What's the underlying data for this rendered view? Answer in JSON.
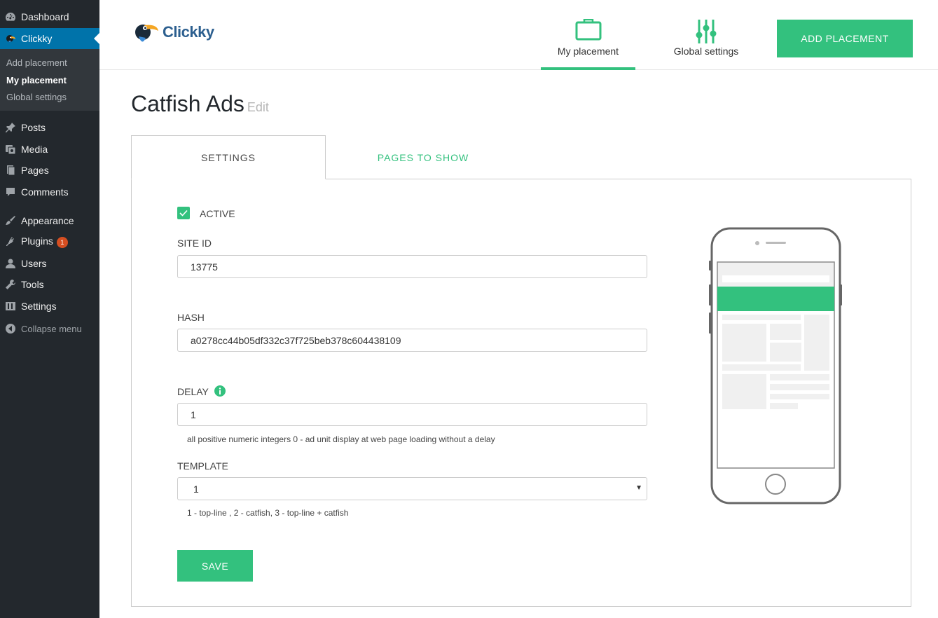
{
  "sidebar": {
    "dashboard": "Dashboard",
    "clickky": "Clickky",
    "submenu": [
      "Add placement",
      "My placement",
      "Global settings"
    ],
    "items": [
      "Posts",
      "Media",
      "Pages",
      "Comments",
      "Appearance",
      "Plugins",
      "Users",
      "Tools",
      "Settings"
    ],
    "plugins_badge": "1",
    "collapse": "Collapse menu"
  },
  "header": {
    "logo_text": "Clickky",
    "nav_my_placement": "My placement",
    "nav_global_settings": "Global settings",
    "add_placement": "ADD PLACEMENT"
  },
  "page": {
    "title": "Catfish Ads",
    "edit": "Edit"
  },
  "tabs": {
    "settings": "SETTINGS",
    "pages_to_show": "PAGES TO SHOW"
  },
  "form": {
    "active_label": "ACTIVE",
    "active_checked": true,
    "site_id_label": "SITE ID",
    "site_id_value": "13775",
    "hash_label": "HASH",
    "hash_value": "a0278cc44b05df332c37f725beb378c604438109",
    "delay_label": "DELAY",
    "delay_value": "1",
    "delay_hint": "all positive numeric integers 0 - ad unit display at web page loading without a delay",
    "template_label": "TEMPLATE",
    "template_value": "1",
    "template_hint": "1 - top-line , 2 - catfish, 3 - top-line + catfish",
    "save": "SAVE"
  },
  "colors": {
    "accent": "#33c17e",
    "sidebar_bg": "#23282d",
    "sidebar_active": "#0073aa",
    "badge": "#d54e21"
  }
}
